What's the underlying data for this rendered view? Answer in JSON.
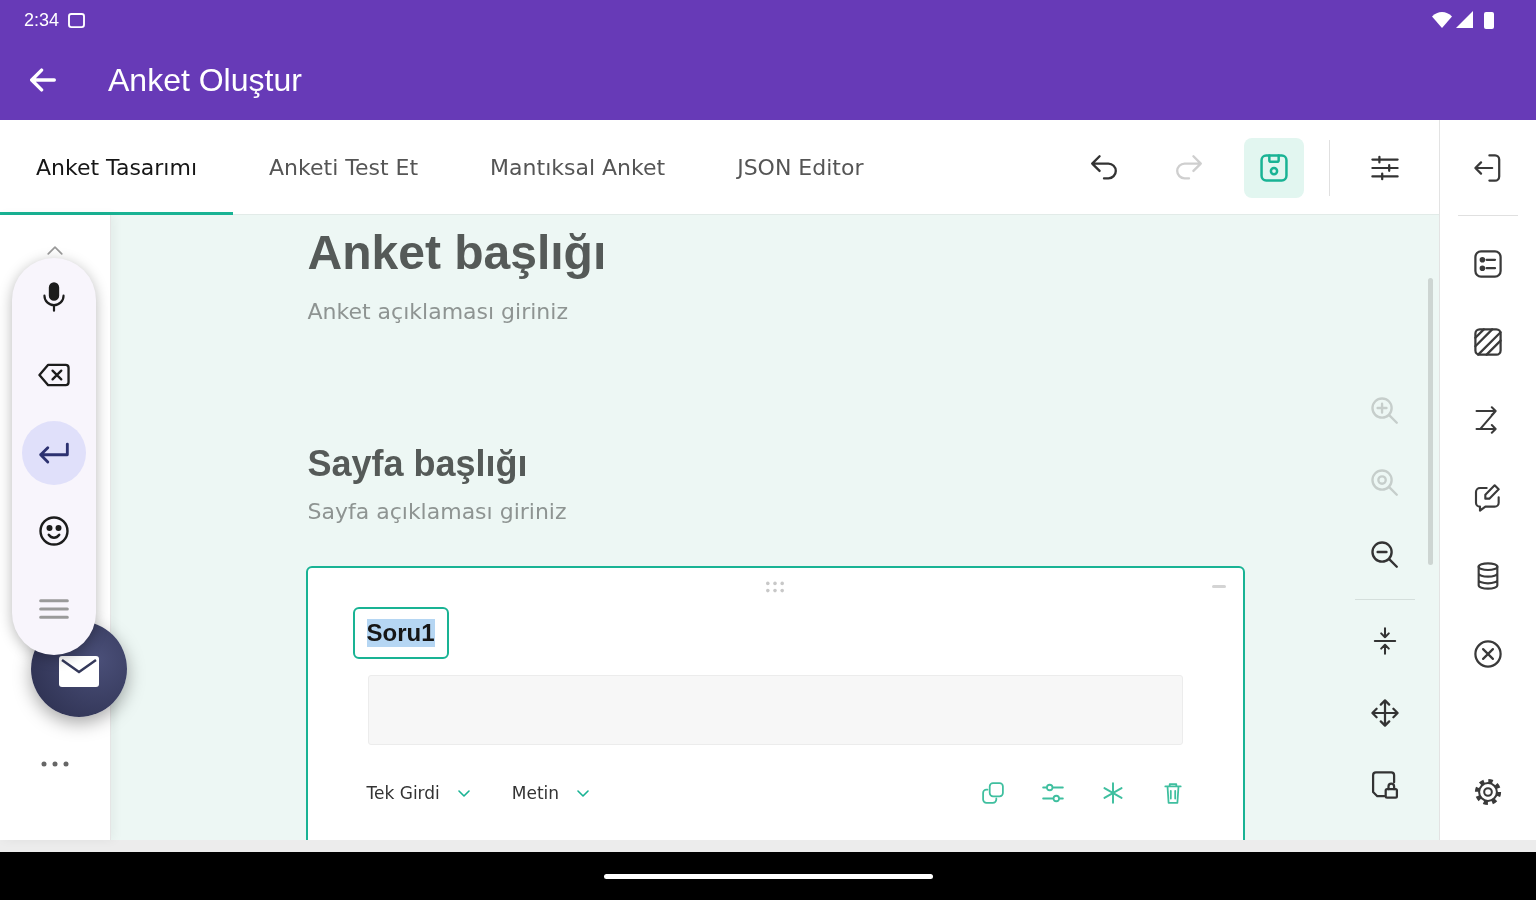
{
  "status_bar": {
    "time": "2:34"
  },
  "app_bar": {
    "title": "Anket Oluştur"
  },
  "tabs": [
    {
      "label": "Anket Tasarımı",
      "selected": true
    },
    {
      "label": "Anketi Test Et",
      "selected": false
    },
    {
      "label": "Mantıksal Anket",
      "selected": false
    },
    {
      "label": "JSON Editor",
      "selected": false
    }
  ],
  "toolbar": [
    {
      "kind": "undo",
      "disabled": false,
      "active": false
    },
    {
      "kind": "redo",
      "disabled": true,
      "active": false
    },
    {
      "kind": "save",
      "disabled": false,
      "active": true
    },
    {
      "kind": "settings",
      "disabled": false,
      "active": false
    }
  ],
  "floating_keyboard": {
    "keys": [
      {
        "kind": "mic",
        "highlighted": false
      },
      {
        "kind": "backspace",
        "highlighted": false
      },
      {
        "kind": "enter",
        "highlighted": true
      },
      {
        "kind": "emoji",
        "highlighted": false
      },
      {
        "kind": "handle",
        "highlighted": false
      }
    ]
  },
  "survey": {
    "title": "Anket başlığı",
    "description": "Anket açıklaması giriniz"
  },
  "page": {
    "title": "Sayfa başlığı",
    "description": "Sayfa açıklaması giriniz"
  },
  "question": {
    "selected": true,
    "name": "Soru1",
    "name_highlighted": true,
    "type": "Tek Girdi",
    "input_type": "Metin"
  },
  "zoom_tools": [
    {
      "kind": "zoom-in",
      "disabled": true
    },
    {
      "kind": "zoom-reset",
      "disabled": true
    },
    {
      "kind": "zoom-out",
      "disabled": false
    }
  ]
}
